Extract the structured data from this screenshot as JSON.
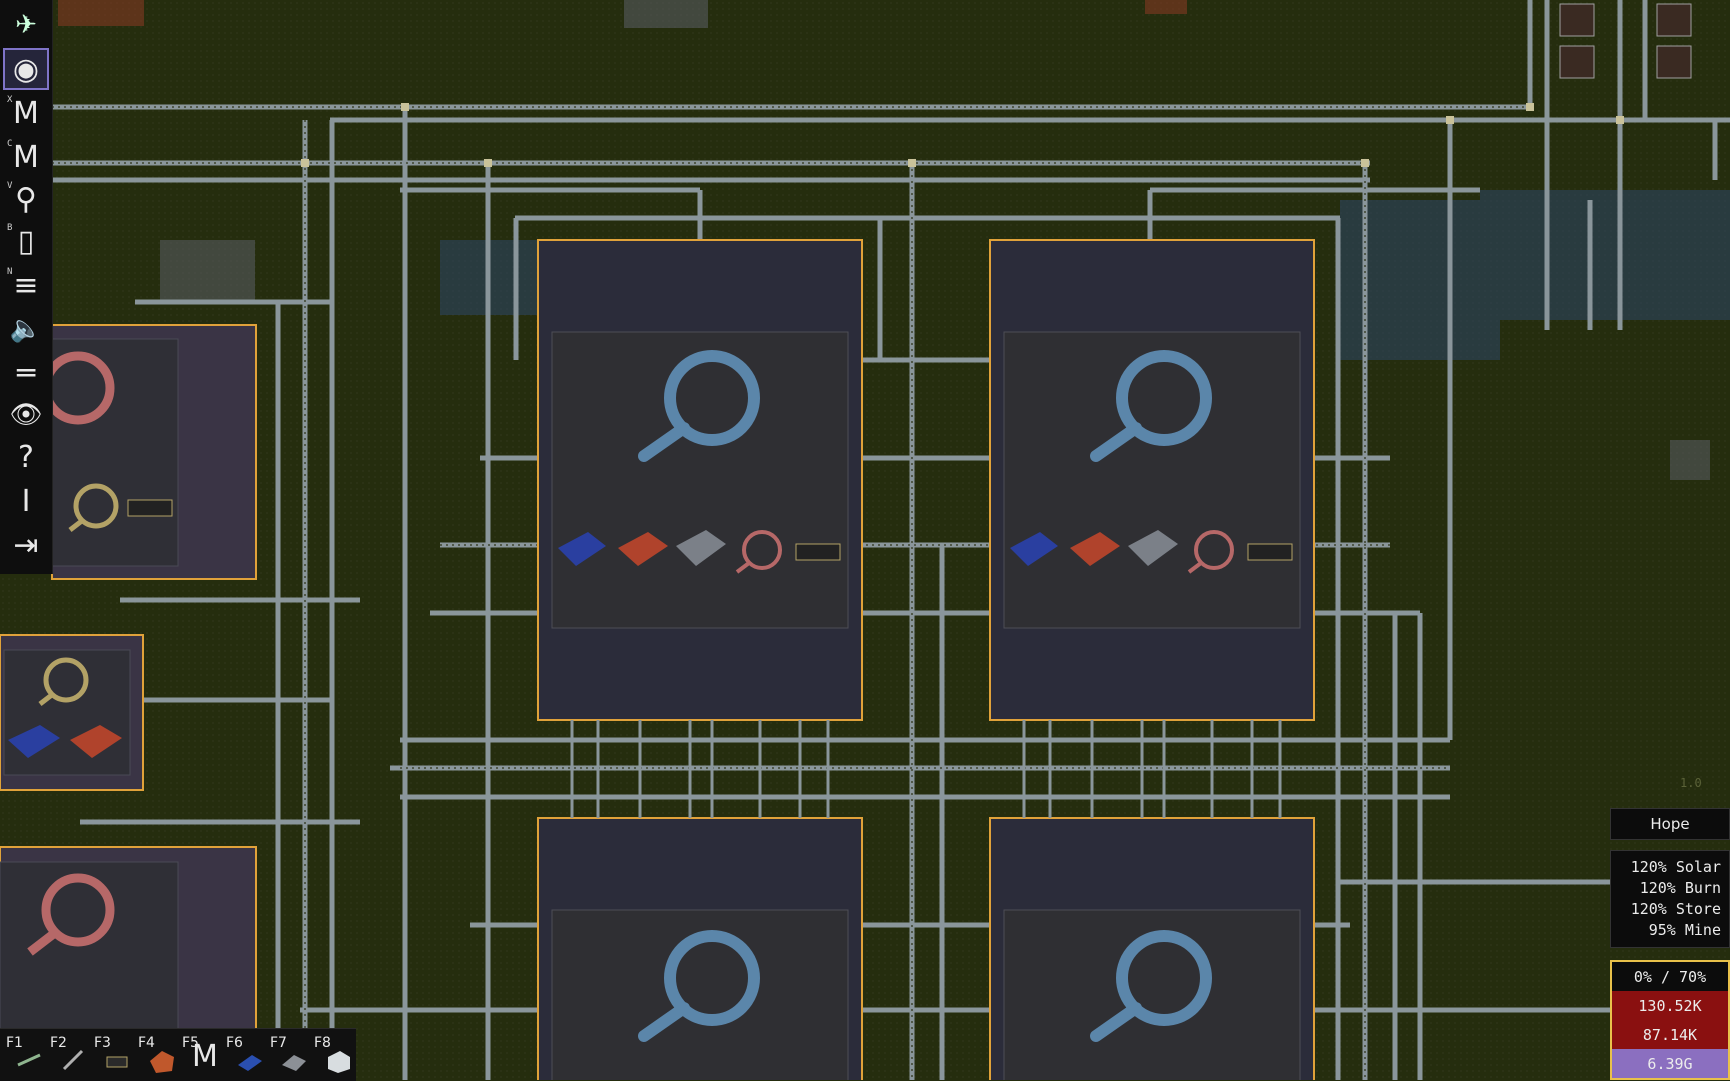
{
  "toolbar": {
    "items": [
      {
        "name": "drone-tool",
        "hotkey": "",
        "glyph": "✈"
      },
      {
        "name": "world-tool",
        "hotkey": "",
        "glyph": "◉"
      },
      {
        "name": "build-tool",
        "hotkey": "X",
        "glyph": "M"
      },
      {
        "name": "move-tool",
        "hotkey": "C",
        "glyph": "M"
      },
      {
        "name": "inspect-tool",
        "hotkey": "V",
        "glyph": "⚲"
      },
      {
        "name": "blueprint-tool",
        "hotkey": "B",
        "glyph": "▢"
      },
      {
        "name": "stats-tool",
        "hotkey": "N",
        "glyph": "≡"
      },
      {
        "name": "sound-tool",
        "hotkey": "",
        "glyph": "🔈"
      },
      {
        "name": "menu-tool",
        "hotkey": "",
        "glyph": "═"
      },
      {
        "name": "view-tool",
        "hotkey": "",
        "glyph": "👁"
      },
      {
        "name": "help-tool",
        "hotkey": "",
        "glyph": "?"
      },
      {
        "name": "info-tool",
        "hotkey": "",
        "glyph": "I"
      },
      {
        "name": "exit-tool",
        "hotkey": "",
        "glyph": "⇥"
      }
    ]
  },
  "hotbar": {
    "slots": [
      {
        "key": "F1",
        "icon": "drone-icon"
      },
      {
        "key": "F2",
        "icon": "tracks-icon"
      },
      {
        "key": "F3",
        "icon": "chip-icon"
      },
      {
        "key": "F4",
        "icon": "copper-ore-icon"
      },
      {
        "key": "F5",
        "icon": "build-icon"
      },
      {
        "key": "F6",
        "icon": "solar-panel-icon"
      },
      {
        "key": "F7",
        "icon": "rock-icon"
      },
      {
        "key": "F8",
        "icon": "crate-icon"
      }
    ]
  },
  "hud": {
    "version": "1.0",
    "faction": "Hope",
    "rates": [
      "120% Solar",
      "120% Burn",
      "120% Store",
      "95% Mine"
    ],
    "power_ratio": "0% / 70%",
    "resource_1": "130.52K",
    "resource_2": "87.14K",
    "resource_3": "6.39G"
  },
  "colors": {
    "ground": "#252d0e",
    "factory_fill": "#2b2c3a",
    "factory_border": "#e0a23a",
    "rail": "#8e9aa0",
    "magnifier_blue": "#5b86aa",
    "magnifier_red": "#b66868",
    "res_red": "#8a1010",
    "res_purple": "#8b6fc0"
  }
}
